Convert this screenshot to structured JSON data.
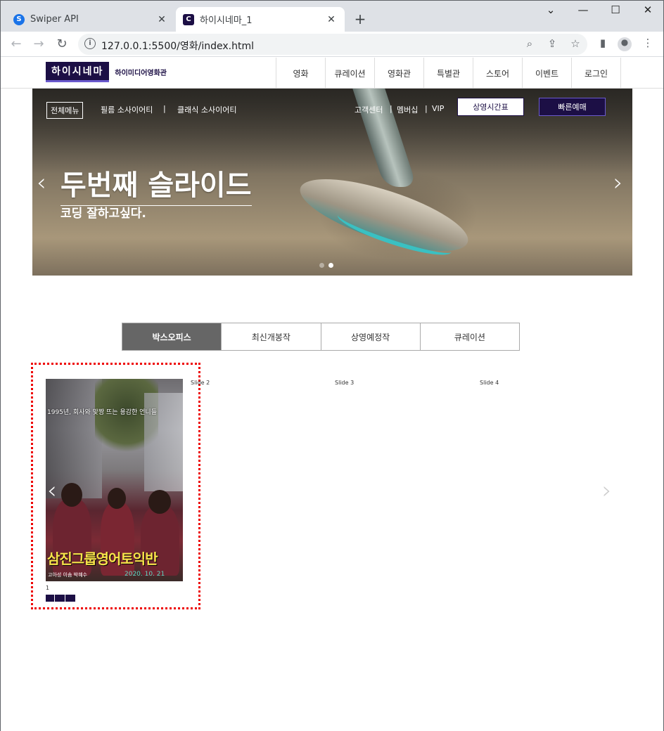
{
  "browser": {
    "tabs": [
      {
        "title": "Swiper API",
        "favicon_icon": "swiper-icon"
      },
      {
        "title": "하이시네마_1",
        "favicon_icon": "c-icon"
      }
    ],
    "url": "127.0.0.1:5500/영화/index.html"
  },
  "site": {
    "logo_main": "하이시네마",
    "logo_sub": "하이미디어영화관",
    "nav": [
      "영화",
      "큐레이션",
      "영화관",
      "특별관",
      "스토어",
      "이벤트",
      "로그인"
    ],
    "hero": {
      "menu_all": "전체메뉴",
      "left_links": [
        "필름 소사이어티",
        "클래식 소사이어티"
      ],
      "right_links": [
        "고객센터",
        "멤버십",
        "VIP"
      ],
      "btn_timetable": "상영시간표",
      "btn_quick": "빠른예매",
      "title": "두번째 슬라이드",
      "subtitle": "코딩 잘하고싶다.",
      "prev_arrow": "‹",
      "next_arrow": "›",
      "active_dot": 2,
      "dot_count": 2
    },
    "movie_tabs": [
      {
        "label": "박스오피스",
        "active": true
      },
      {
        "label": "최신개봉작",
        "active": false
      },
      {
        "label": "상영예정작",
        "active": false
      },
      {
        "label": "큐레이션",
        "active": false
      }
    ],
    "movie_slider": {
      "poster": {
        "tagline": "1995년, 회사와 맞짱 뜨는 용감한 언니들",
        "title": "삼진그룹영어토익반",
        "date": "2020. 10. 21",
        "cast": "고아성  이솜  박혜수"
      },
      "rank": "1",
      "other_slides": [
        "Slide 2",
        "Slide 3",
        "Slide 4"
      ],
      "prev_arrow": "‹",
      "next_arrow": "›"
    }
  }
}
